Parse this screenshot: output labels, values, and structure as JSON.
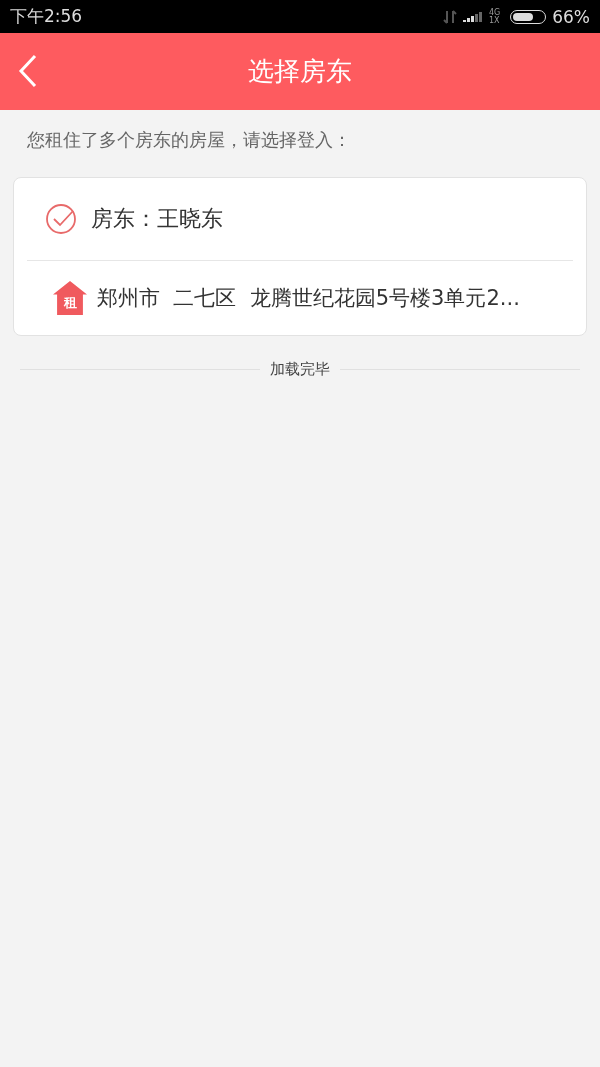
{
  "status_bar": {
    "time": "下午2:56",
    "network_top": "4G",
    "network_bottom": "1X",
    "battery": "66%"
  },
  "header": {
    "title": "选择房东"
  },
  "prompt": "您租住了多个房东的房屋，请选择登入：",
  "landlords": [
    {
      "name": "房东：王晓东",
      "selected": true,
      "badge": "租",
      "address": "郑州市  二七区  龙腾世纪花园5号楼3单元2..."
    }
  ],
  "footer": "加载完毕"
}
